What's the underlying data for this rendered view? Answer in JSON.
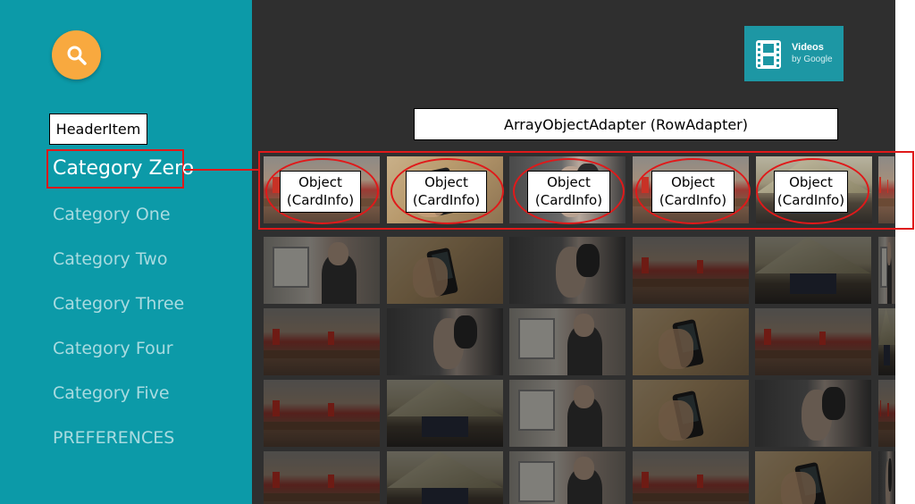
{
  "sidebar": {
    "search_icon": "search-icon",
    "header_item_label": "HeaderItem",
    "categories": [
      "Category Zero",
      "Category One",
      "Category Two",
      "Category Three",
      "Category Four",
      "Category Five"
    ],
    "preferences_label": "PREFERENCES"
  },
  "logo": {
    "line1": "Videos",
    "line2": "by Google",
    "icon": "film-icon"
  },
  "row_adapter_label": "ArrayObjectAdapter (RowAdapter)",
  "cards": [
    {
      "line1": "Object",
      "line2": "(CardInfo)"
    },
    {
      "line1": "Object",
      "line2": "(CardInfo)"
    },
    {
      "line1": "Object",
      "line2": "(CardInfo)"
    },
    {
      "line1": "Object",
      "line2": "(CardInfo)"
    },
    {
      "line1": "Object",
      "line2": "(CardInfo)"
    }
  ],
  "colors": {
    "sidebar_bg": "#0c9aa8",
    "main_bg": "#2f2f2f",
    "search_button": "#f8a93f",
    "annotation_red": "#e0191a",
    "category_selected": "#ffffff",
    "category_unselected": "#a9dbe0"
  }
}
